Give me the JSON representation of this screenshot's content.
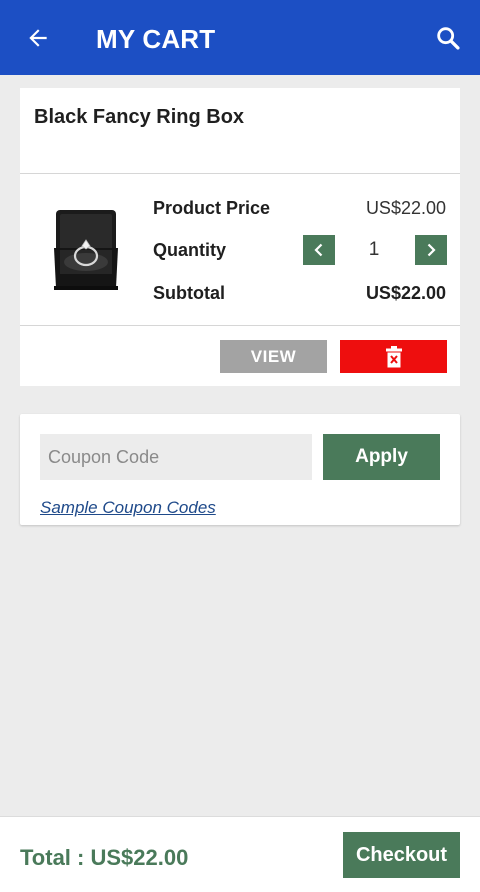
{
  "header": {
    "title": "MY CART",
    "back_icon": "arrow-left-icon",
    "search_icon": "search-icon",
    "bg_color": "#1c4fc4"
  },
  "cart": {
    "items": [
      {
        "name": "Black Fancy Ring Box",
        "image_icon": "ring-box-image",
        "price_label": "Product Price",
        "price": "US$22.00",
        "quantity_label": "Quantity",
        "quantity": "1",
        "subtotal_label": "Subtotal",
        "subtotal": "US$22.00",
        "view_label": "VIEW",
        "delete_icon": "trash-icon"
      }
    ]
  },
  "coupon": {
    "placeholder": "Coupon Code",
    "value": "",
    "apply_label": "Apply",
    "sample_link": "Sample Coupon Codes"
  },
  "footer": {
    "total": "Total : US$22.00",
    "checkout_label": "Checkout"
  },
  "colors": {
    "accent_green": "#4a7a5a",
    "delete_red": "#ee0e0e",
    "view_gray": "#a3a3a3",
    "link_blue": "#1f4a8a"
  }
}
